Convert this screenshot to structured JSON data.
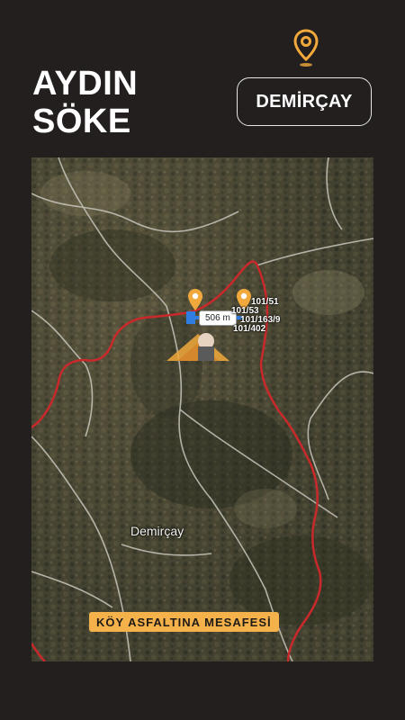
{
  "header": {
    "title_line1": "AYDIN",
    "title_line2": "SÖKE",
    "location_badge": "DEMİRÇAY",
    "pin_color": "#f2a93b"
  },
  "map": {
    "distance_label": "506 m",
    "parcel_labels": [
      "101/51",
      "101/53",
      "101/163/9",
      "101/402"
    ],
    "place_name": "Demirçay",
    "boundary_color": "#c9292b",
    "marker_color": "#f2a93b",
    "measure_color": "#2f7de1",
    "marker_icon": "location-pin-icon",
    "logo_icon": "agent-logo-icon"
  },
  "caption": {
    "text": "KÖY ASFALTINA MESAFESİ"
  }
}
